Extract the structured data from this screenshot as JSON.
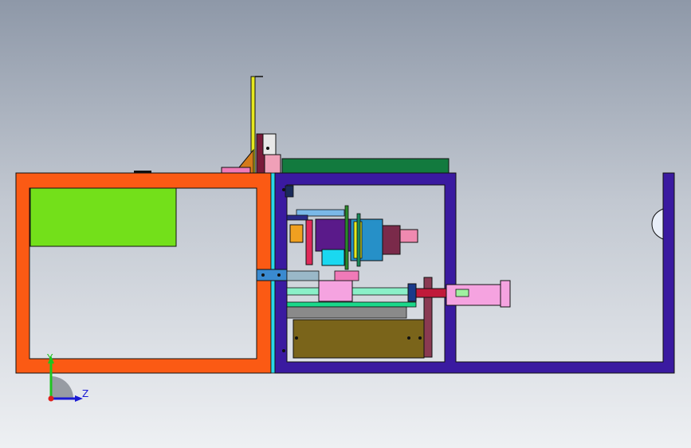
{
  "viewport": {
    "background_top": "#8e98a8",
    "background_bottom": "#eef0f3"
  },
  "triad": {
    "y_label": "Y",
    "z_label": "Z",
    "x_color": "#e0201c",
    "y_color": "#1fc41f",
    "z_color": "#1a1ad4"
  },
  "parts": {
    "orange_frame": "#fb5a14",
    "green_panel": "#73e01a",
    "purple_frame": "#3a1aa0",
    "olive_block": "#7a641a",
    "teal_plate": "#127a3e",
    "pink_cylinder": "#f5a3e0",
    "cyan_block": "#1ad8f0",
    "blue_motor": "#2690c8",
    "maroon_post": "#8a3a52"
  }
}
